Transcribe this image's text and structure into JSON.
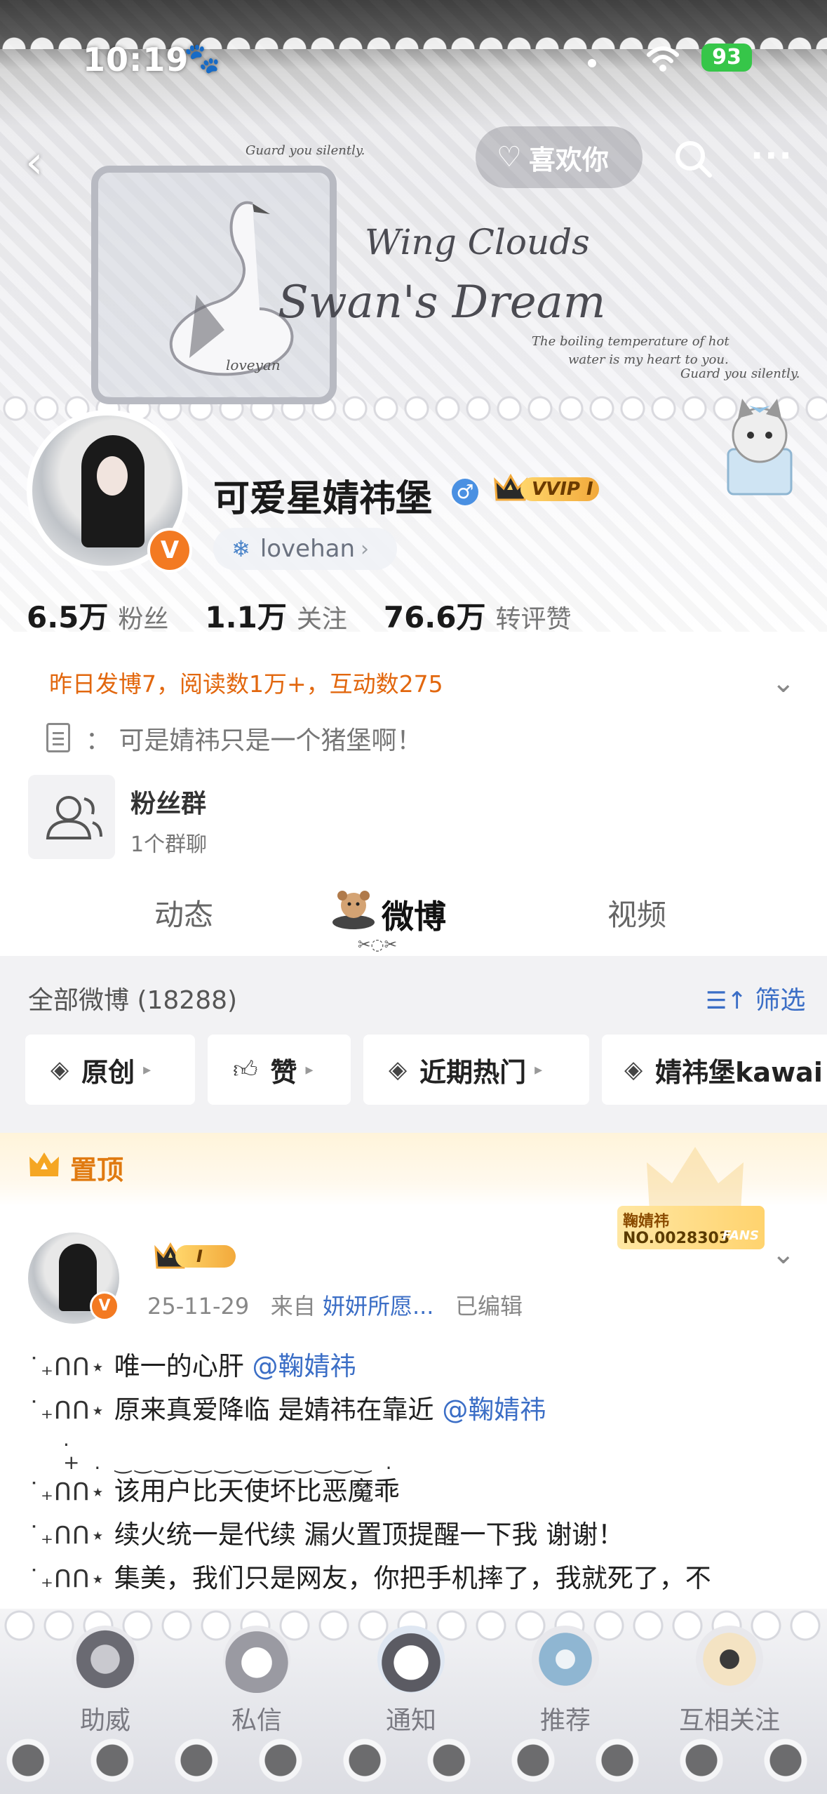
{
  "status_bar": {
    "time": "10:19",
    "battery": "93"
  },
  "nav": {
    "like_label": "喜欢你"
  },
  "banner": {
    "title_line1": "Wing Clouds",
    "title_line2": "Swan's Dream",
    "caption_left": "Guard you silently.",
    "caption_swan": "loveyan",
    "caption_right1": "The boiling temperature of hot",
    "caption_right2": "water is my heart to you.",
    "caption_right3": "Guard you silently."
  },
  "profile": {
    "username": "可爱星婧祎堡",
    "gender_symbol": "♂",
    "vip_label": "VVIP I",
    "verified_badge": "V",
    "tag_label": "lovehan",
    "stats": [
      {
        "num": "6.5万",
        "label": "粉丝"
      },
      {
        "num": "1.1万",
        "label": "关注"
      },
      {
        "num": "76.6万",
        "label": "转评赞"
      }
    ],
    "activity": "昨日发博7，阅读数1万+，互动数275",
    "bio_prefix": "：",
    "bio": "可是婧祎只是一个猪堡啊！",
    "group": {
      "title": "粉丝群",
      "subtitle": "1个群聊"
    }
  },
  "tabs": [
    {
      "label": "动态",
      "active": false
    },
    {
      "label": "微博",
      "active": true
    },
    {
      "label": "视频",
      "active": false
    }
  ],
  "feed": {
    "all_count": "全部微博 (18288)",
    "filter_label": "筛选",
    "chips": [
      "原创",
      "赞",
      "近期热门",
      "婧祎堡kawai"
    ]
  },
  "pinned": {
    "label": "置顶",
    "fan_badge_name": "鞠婧祎",
    "fan_badge_no": "NO.0028303",
    "fan_badge_fans": "FANS",
    "vip_label": "I",
    "date": "25-11-29",
    "source_prefix": "来自",
    "source": "妍妍所愿...",
    "edited": "已编辑",
    "lines": [
      {
        "kao": "˙₊ᑎᑎ⋆",
        "text": "唯一的心肝",
        "mention": "@鞠婧祎"
      },
      {
        "kao": "˙₊ᑎᑎ⋆",
        "text": "原来真爱降临 是婧祎在靠近",
        "mention": "@鞠婧祎"
      },
      {
        "kao": "˙₊ᑎᑎ⋆",
        "text": "该用户比天使坏比恶魔乖",
        "mention": ""
      },
      {
        "kao": "˙₊ᑎᑎ⋆",
        "text": "续火统一是代续 漏火置顶提醒一下我 谢谢！",
        "mention": ""
      },
      {
        "kao": "˙₊ᑎᑎ⋆",
        "text": "集美，我们只是网友，你把手机摔了，我就死了，不",
        "mention": ""
      }
    ]
  },
  "bottom_tabs": [
    {
      "label": "助威",
      "icon": "cookie-icon"
    },
    {
      "label": "私信",
      "icon": "cat-icon"
    },
    {
      "label": "通知",
      "icon": "puppy-icon"
    },
    {
      "label": "推荐",
      "icon": "donut-icon"
    },
    {
      "label": "互相关注",
      "icon": "macaron-icon"
    }
  ],
  "colors": {
    "accent_orange": "#e2670e",
    "link_blue": "#3b6ec6",
    "verified_orange": "#f37a22",
    "vip_gold": "#f2a93b"
  }
}
